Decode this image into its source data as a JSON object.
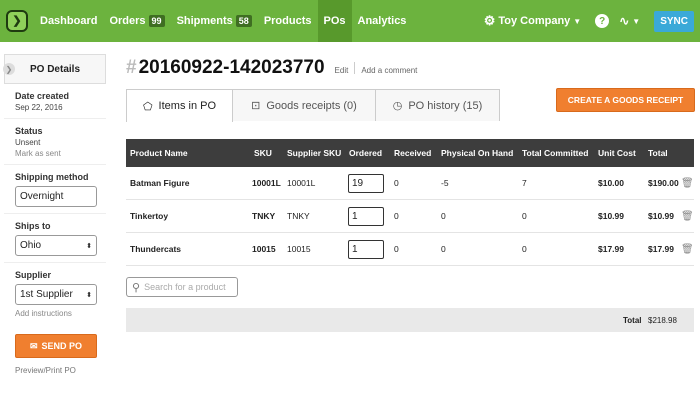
{
  "nav": {
    "items": [
      {
        "label": "Dashboard"
      },
      {
        "label": "Orders",
        "badge": "99"
      },
      {
        "label": "Shipments",
        "badge": "58"
      },
      {
        "label": "Products"
      },
      {
        "label": "POs"
      },
      {
        "label": "Analytics"
      }
    ],
    "company": "Toy Company",
    "help": "?",
    "sync": "SYNC"
  },
  "sidebar": {
    "title": "PO Details",
    "date_label": "Date created",
    "date_value": "Sep 22, 2016",
    "status_label": "Status",
    "status_value": "Unsent",
    "mark_sent": "Mark as sent",
    "shipping_label": "Shipping method",
    "shipping_value": "Overnight",
    "ships_to_label": "Ships to",
    "ships_to_value": "Ohio",
    "supplier_label": "Supplier",
    "supplier_value": "1st Supplier",
    "add_instructions": "Add instructions",
    "send_po": "SEND PO",
    "preview": "Preview/Print PO"
  },
  "po": {
    "hash": "#",
    "number": "20160922-142023770",
    "edit": "Edit",
    "add_comment": "Add a comment"
  },
  "tabs": [
    {
      "label": "Items in PO"
    },
    {
      "label": "Goods receipts (0)"
    },
    {
      "label": "PO history (15)"
    }
  ],
  "create_goods_receipt": "CREATE A GOODS RECEIPT",
  "table": {
    "headers": [
      "Product Name",
      "SKU",
      "Supplier SKU",
      "Ordered",
      "Received",
      "Physical On Hand",
      "Total Committed",
      "Unit Cost",
      "Total"
    ],
    "rows": [
      {
        "name": "Batman Figure",
        "sku": "10001L",
        "supplier_sku": "10001L",
        "ordered": "19",
        "received": "0",
        "on_hand": "-5",
        "committed": "7",
        "unit_cost": "$10.00",
        "total": "$190.00"
      },
      {
        "name": "Tinkertoy",
        "sku": "TNKY",
        "supplier_sku": "TNKY",
        "ordered": "1",
        "received": "0",
        "on_hand": "0",
        "committed": "0",
        "unit_cost": "$10.99",
        "total": "$10.99"
      },
      {
        "name": "Thundercats",
        "sku": "10015",
        "supplier_sku": "10015",
        "ordered": "1",
        "received": "0",
        "on_hand": "0",
        "committed": "0",
        "unit_cost": "$17.99",
        "total": "$17.99"
      }
    ]
  },
  "search_placeholder": "Search for a product",
  "total_label": "Total",
  "total_value": "$218.98",
  "colors": {
    "nav_green": "#6cb33e",
    "accent_orange": "#f07f2f",
    "sync_blue": "#3aa9d8",
    "table_header": "#3d3d3d"
  }
}
